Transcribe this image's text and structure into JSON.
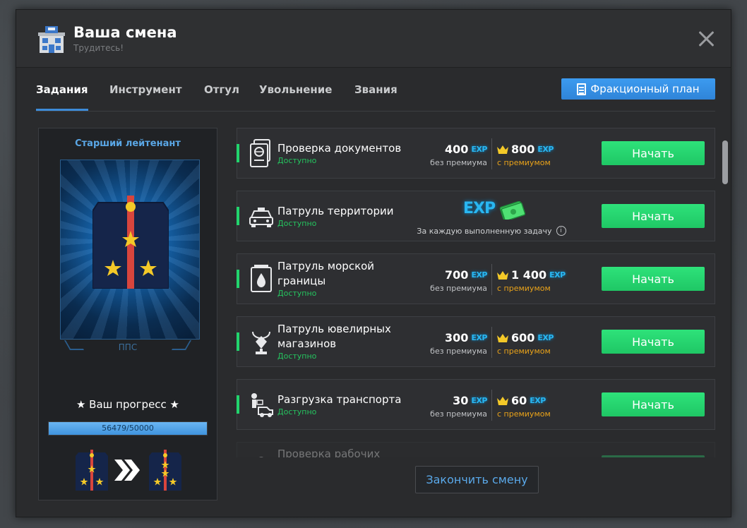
{
  "window": {
    "title": "Ваша смена",
    "subtitle": "Трудитесь!"
  },
  "tabs": [
    {
      "label": "Задания",
      "active": true
    },
    {
      "label": "Инструмент"
    },
    {
      "label": "Отгул"
    },
    {
      "label": "Увольнение"
    },
    {
      "label": "Звания"
    }
  ],
  "plan_button": {
    "label": "Фракционный план"
  },
  "rank": {
    "title": "Старший лейтенант",
    "department": "ППС",
    "progress_label": "★ Ваш прогресс ★",
    "progress_text": "56479/50000",
    "progress_fraction": 1.0
  },
  "labels": {
    "exp": "EXP",
    "no_premium": "без премиума",
    "with_premium": "с премиумом",
    "start": "Начать",
    "available": "Доступно",
    "each_task": "За каждую выполненную задачу"
  },
  "tasks": [
    {
      "name": "Проверка документов",
      "status": "Доступно",
      "base": "400",
      "premium": "800",
      "icon": "passport-icon"
    },
    {
      "name": "Патруль территории",
      "status": "Доступно",
      "icon": "car-icon",
      "reward_type": "per-task"
    },
    {
      "name": "Патруль морской\nграницы",
      "status": "Доступно",
      "base": "700",
      "premium": "1 400",
      "icon": "buoy-icon"
    },
    {
      "name": "Патруль ювелирных\nмагазинов",
      "status": "Доступно",
      "base": "300",
      "premium": "600",
      "icon": "jewelry-icon"
    },
    {
      "name": "Разгрузка транспорта",
      "status": "Доступно",
      "base": "30",
      "premium": "60",
      "icon": "loader-truck-icon"
    },
    {
      "name": "Проверка рабочих",
      "icon": "worker-icon"
    }
  ],
  "finish_button": {
    "label": "Закончить смену"
  },
  "colors": {
    "accent_blue": "#3d8bd8",
    "start_green": "#1fc765",
    "premium_gold": "#e8a21a",
    "exp_blue": "#29b7f2"
  }
}
